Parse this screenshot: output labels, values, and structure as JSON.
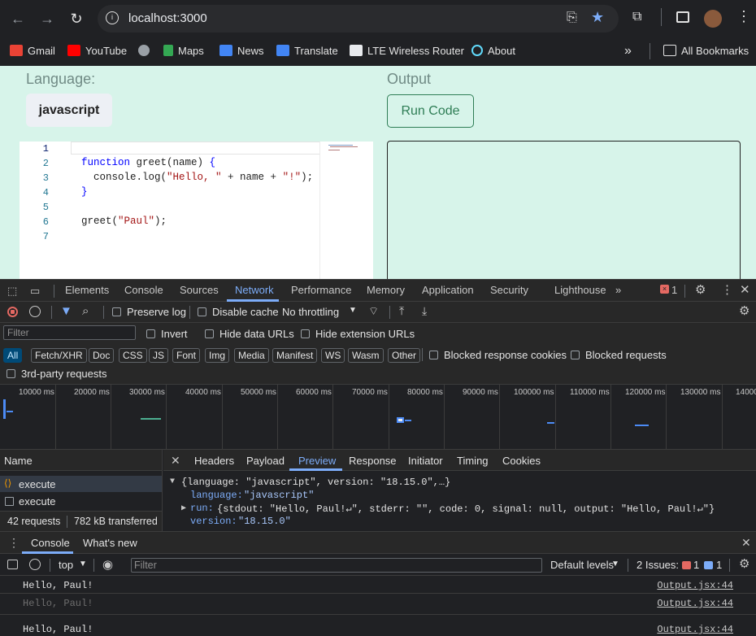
{
  "browser": {
    "url": "localhost:3000",
    "bookmarks": [
      "Gmail",
      "YouTube",
      "Maps",
      "News",
      "Translate",
      "LTE Wireless Router",
      "About"
    ],
    "all_bookmarks": "All Bookmarks"
  },
  "app": {
    "language_label": "Language:",
    "language_value": "javascript",
    "output_label": "Output",
    "run_label": "Run Code",
    "line_numbers": [
      "1",
      "2",
      "3",
      "4",
      "5",
      "6",
      "7"
    ]
  },
  "devtools": {
    "tabs": [
      "Elements",
      "Console",
      "Sources",
      "Network",
      "Performance",
      "Memory",
      "Application",
      "Security",
      "Lighthouse"
    ],
    "active_tab": "Network",
    "error_count": "1",
    "toolbar": {
      "preserve_log": "Preserve log",
      "disable_cache": "Disable cache",
      "throttling": "No throttling"
    },
    "filter": {
      "placeholder": "Filter",
      "invert": "Invert",
      "hide_data": "Hide data URLs",
      "hide_ext": "Hide extension URLs"
    },
    "types": [
      "All",
      "Fetch/XHR",
      "Doc",
      "CSS",
      "JS",
      "Font",
      "Img",
      "Media",
      "Manifest",
      "WS",
      "Wasm",
      "Other"
    ],
    "blocked_cookies": "Blocked response cookies",
    "blocked_requests": "Blocked requests",
    "third_party": "3rd-party requests",
    "timeline_ticks": [
      "10000 ms",
      "20000 ms",
      "30000 ms",
      "40000 ms",
      "50000 ms",
      "60000 ms",
      "70000 ms",
      "80000 ms",
      "90000 ms",
      "100000 ms",
      "110000 ms",
      "120000 ms",
      "130000 ms",
      "14000"
    ],
    "name_header": "Name",
    "requests": [
      "execute",
      "execute"
    ],
    "summary": {
      "requests": "42 requests",
      "transferred": "782 kB transferred"
    },
    "detail_tabs": [
      "Headers",
      "Payload",
      "Preview",
      "Response",
      "Initiator",
      "Timing",
      "Cookies"
    ],
    "active_detail": "Preview",
    "preview": {
      "line1": "{language: \"javascript\", version: \"18.15.0\",…}",
      "language_key": "language:",
      "language_val": "\"javascript\"",
      "run_key": "run:",
      "run_val": "{stdout: \"Hello, Paul!↵\", stderr: \"\", code: 0, signal: null, output: \"Hello, Paul!↵\"}",
      "version_key": "version:",
      "version_val": "\"18.15.0\""
    },
    "drawer": {
      "tabs": [
        "Console",
        "What's new"
      ],
      "context": "top",
      "filter_placeholder": "Filter",
      "levels": "Default levels",
      "issues_label": "2 Issues:",
      "issues_err": "1",
      "issues_info": "1",
      "messages": [
        {
          "text": "Hello, Paul!",
          "src": "Output.jsx:44"
        },
        {
          "text": "Hello, Paul!",
          "src": "Output.jsx:44"
        },
        {
          "text": "Hello, Paul!",
          "src": "Output.jsx:44"
        }
      ]
    }
  }
}
